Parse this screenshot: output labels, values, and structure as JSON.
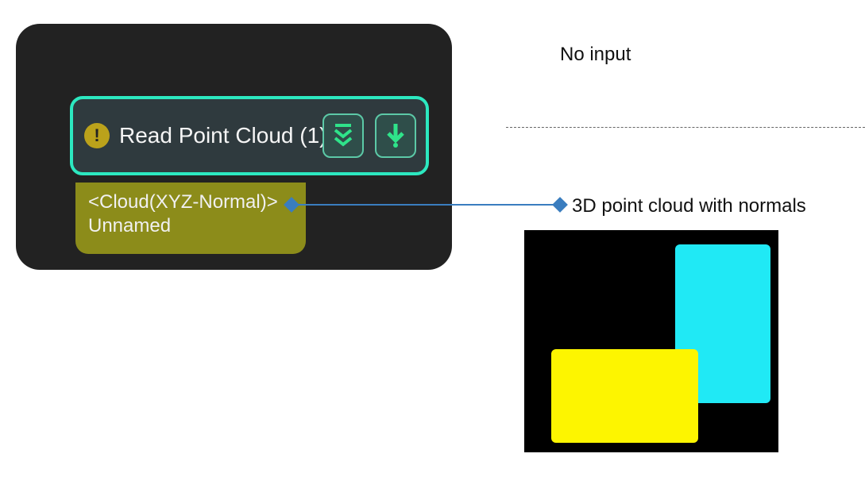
{
  "node": {
    "title_label": "Read Point Cloud (1)",
    "output_type_label": "<Cloud(XYZ-Normal)>",
    "output_name_label": "Unnamed"
  },
  "right": {
    "no_input_label": "No input",
    "output_description_label": "3D point cloud with normals"
  },
  "icons": {
    "warn": "warning-icon",
    "expand": "expand-all-icon",
    "download": "download-icon"
  },
  "colors": {
    "panel_bg": "#222222",
    "header_border": "#2CE8C0",
    "header_bg": "#2F3A3E",
    "warn_bg": "#BBA21B",
    "btn_bg": "#2F4E4A",
    "btn_border": "#5CC9A7",
    "pill_bg": "#8C8C1A",
    "connector": "#3A7DBF",
    "preview_yellow": "#FDF500",
    "preview_cyan": "#20E9F5"
  }
}
